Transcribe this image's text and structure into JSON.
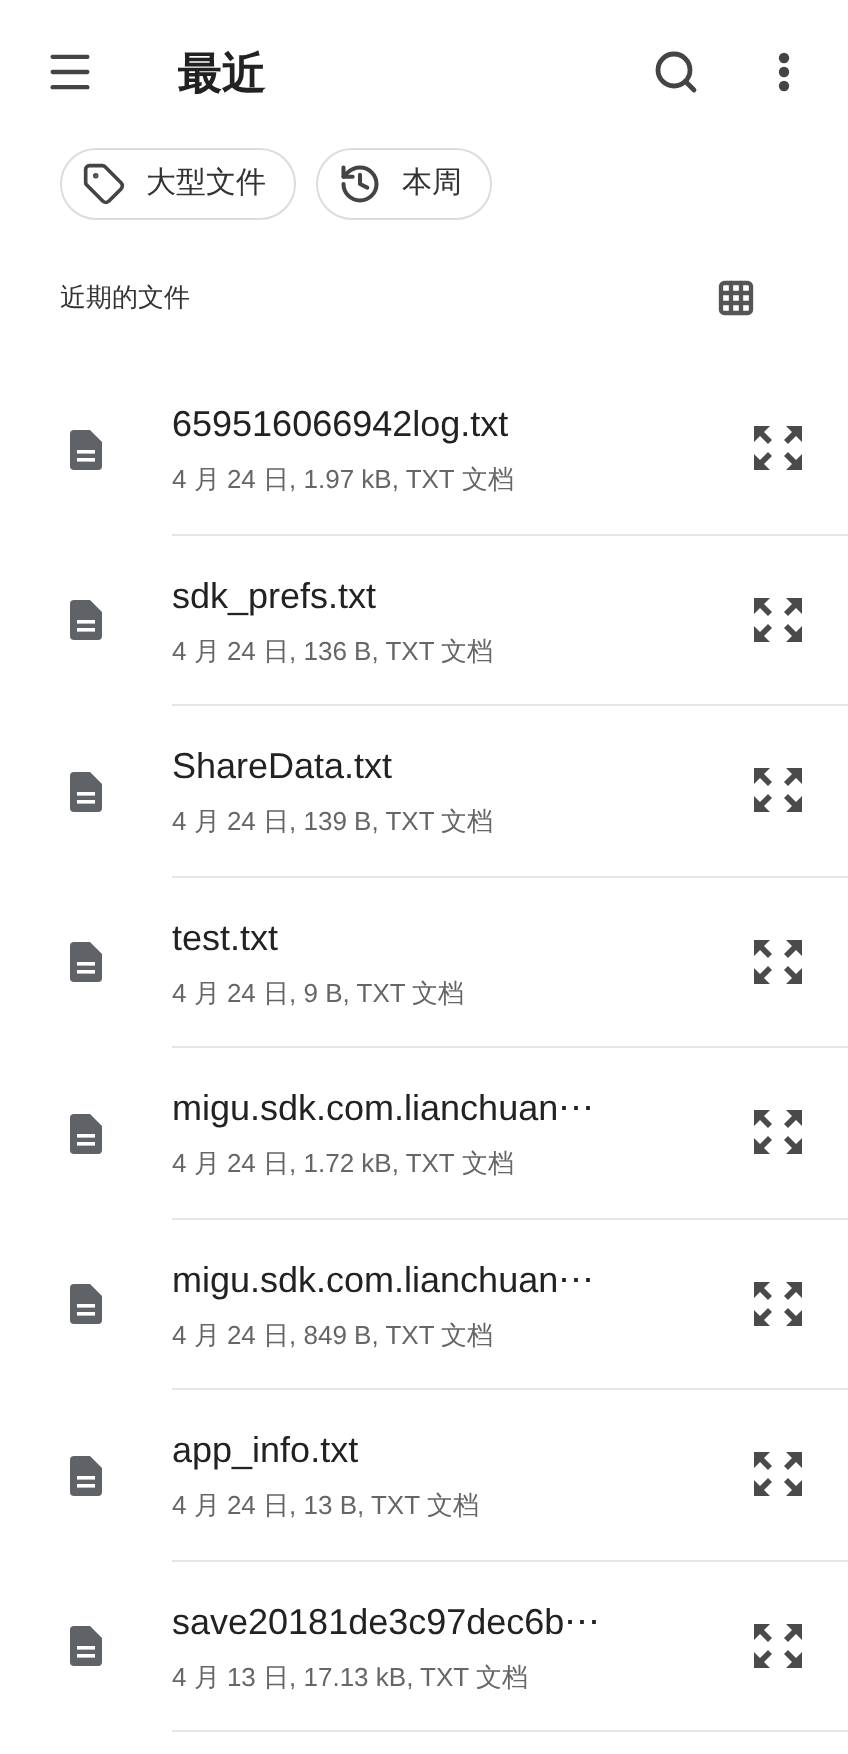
{
  "app_bar": {
    "title": "最近"
  },
  "chips": [
    {
      "kind": "tag",
      "label": "大型文件"
    },
    {
      "kind": "history",
      "label": "本周"
    }
  ],
  "section": {
    "title": "近期的文件"
  },
  "files": [
    {
      "name": "659516066942log.txt",
      "meta": "4 月 24 日, 1.97 kB, TXT 文档"
    },
    {
      "name": "sdk_prefs.txt",
      "meta": "4 月 24 日, 136 B, TXT 文档"
    },
    {
      "name": "ShareData.txt",
      "meta": "4 月 24 日, 139 B, TXT 文档"
    },
    {
      "name": "test.txt",
      "meta": "4 月 24 日, 9 B, TXT 文档"
    },
    {
      "name": "migu.sdk.com.lianchuan⋯",
      "meta": "4 月 24 日, 1.72 kB, TXT 文档"
    },
    {
      "name": "migu.sdk.com.lianchuan⋯",
      "meta": "4 月 24 日, 849 B, TXT 文档"
    },
    {
      "name": "app_info.txt",
      "meta": "4 月 24 日, 13 B, TXT 文档"
    },
    {
      "name": "save20181de3c97dec6b⋯",
      "meta": "4 月 13 日, 17.13 kB, TXT 文档"
    }
  ]
}
